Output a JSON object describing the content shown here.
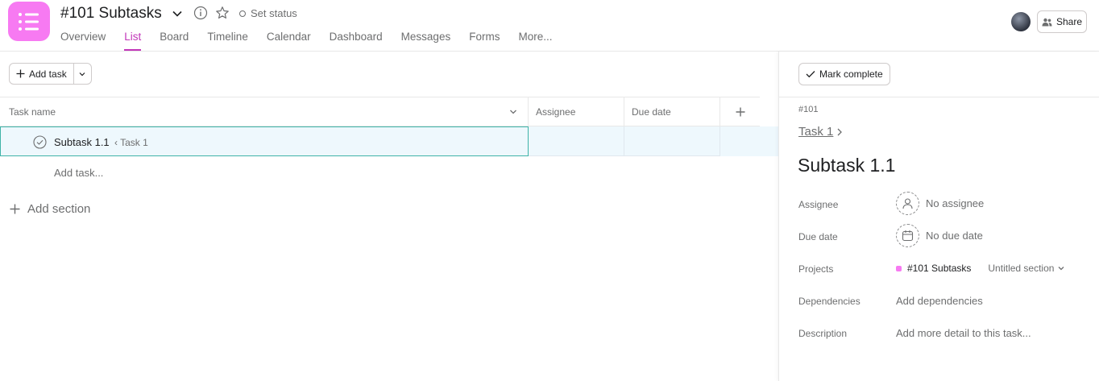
{
  "header": {
    "title": "#101 Subtasks",
    "set_status": "Set status",
    "share": "Share",
    "brand_color": "#f77af2",
    "accent_color": "#c236b9",
    "tabs": [
      {
        "label": "Overview"
      },
      {
        "label": "List"
      },
      {
        "label": "Board"
      },
      {
        "label": "Timeline"
      },
      {
        "label": "Calendar"
      },
      {
        "label": "Dashboard"
      },
      {
        "label": "Messages"
      },
      {
        "label": "Forms"
      },
      {
        "label": "More..."
      }
    ],
    "active_tab": "List"
  },
  "list": {
    "add_task": "Add task",
    "columns": {
      "name": "Task name",
      "assignee": "Assignee",
      "due": "Due date"
    },
    "rows": [
      {
        "name": "Subtask 1.1",
        "parent": "‹ Task 1"
      }
    ],
    "add_task_inline": "Add task...",
    "add_section": "Add section"
  },
  "detail": {
    "mark_complete": "Mark complete",
    "task_id": "#101",
    "parent": "Task 1",
    "title": "Subtask 1.1",
    "fields": {
      "assignee_label": "Assignee",
      "assignee_value": "No assignee",
      "due_label": "Due date",
      "due_value": "No due date",
      "projects_label": "Projects",
      "project_name": "#101 Subtasks",
      "project_section": "Untitled section",
      "dependencies_label": "Dependencies",
      "dependencies_value": "Add dependencies",
      "description_label": "Description",
      "description_value": "Add more detail to this task..."
    }
  }
}
